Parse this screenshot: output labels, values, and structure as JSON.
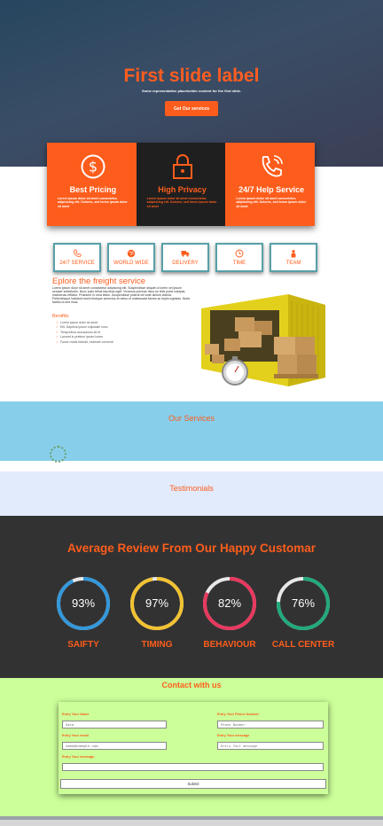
{
  "colors": {
    "accent": "#fd5d1c",
    "dark": "#1f1f1f",
    "services_bg": "#87ceeb",
    "testimonials_bg": "#e2ebfc",
    "review_bg": "#323232",
    "contact_bg": "#ccff99"
  },
  "hero": {
    "title": "First slide label",
    "subtitle": "Some representative placeholder content for the first slide.",
    "button": "Get Our services"
  },
  "features": [
    {
      "icon": "dollar-icon",
      "title": "Best Pricing",
      "text": "Lorem ipsum dolor sit amet consectetur, adipisicing elit. Dolores, sed lorem ipsum dolor sit amet"
    },
    {
      "icon": "lock-icon",
      "title": "High Privacy",
      "text": "Lorem ipsum dolor sit amet consectetur, adipisicing elit. Dolores, sed lorem ipsum dolor sit amet"
    },
    {
      "icon": "phone-icon",
      "title": "24/7 Help Service",
      "text": "Lorem ipsum dolor sit amet consectetur, adipisicing elit. Dolores, sed lorem ipsum dolor sit amet"
    }
  ],
  "tiles": [
    {
      "icon": "phone-icon",
      "label": "24/7 SERVICE"
    },
    {
      "icon": "globe-icon",
      "label": "WORLD WIDE"
    },
    {
      "icon": "truck-icon",
      "label": "DELIVERY"
    },
    {
      "icon": "clock-icon",
      "label": "TIME"
    },
    {
      "icon": "team-icon",
      "label": "TEAM"
    }
  ],
  "explore": {
    "title": "Eplore the freight service",
    "text": "Lorem ipsum dolor sit amet consectetur adipiscing elit. Suspendisse aliquet ut lorem vel ipsum semper sollicitudin. Nunc justo tellus faucibus eget. Vivamus pulvinar risus eu felis porta volutpat, maecenas efficitur. Praesent in urna tellus. Suspendisse potenti vel ante dictum lacinia. Pellentesque habitant morbi tristique senectus et netus et malesuada fames ac turpis egestas. Nulla facilisi ut sed risus.",
    "benefits_label": "Benifits:",
    "benefits": [
      "Lorem ipsum dolor sit amet",
      "Elit. Dapibus ipsum vulputate nunc",
      "Temporibus accusamus sit et",
      "Laoreet in pretium ipsum lorem",
      "Fusce mollis blandit, molestie convenit"
    ]
  },
  "services": {
    "heading": "Our Services"
  },
  "testimonials": {
    "heading": "Testimonials"
  },
  "review": {
    "title": "Average Review From Our Happy Customar",
    "items": [
      {
        "value": "93%",
        "label": "SAIFTY",
        "fraction": 0.93,
        "color": "#3498db"
      },
      {
        "value": "97%",
        "label": "TIMING",
        "fraction": 0.97,
        "color": "#f1c232"
      },
      {
        "value": "82%",
        "label": "BEHAVIOUR",
        "fraction": 0.82,
        "color": "#e8385e"
      },
      {
        "value": "76%",
        "label": "CALL CENTER",
        "fraction": 0.76,
        "color": "#22a97e"
      }
    ]
  },
  "contact": {
    "heading": "Contact with us",
    "name_label": "Entry Your Name",
    "name_value": "Sara",
    "phone_label": "Entry Your Phone Number",
    "phone_placeholder": "Phone Number",
    "email_label": "Entry Your email",
    "email_value": "name@example.com",
    "msg1_label": "Entry Your message",
    "msg1_placeholder": "Entry Your message",
    "msg2_label": "Entry Your message",
    "msg2_value": "",
    "submit": "Submit"
  }
}
